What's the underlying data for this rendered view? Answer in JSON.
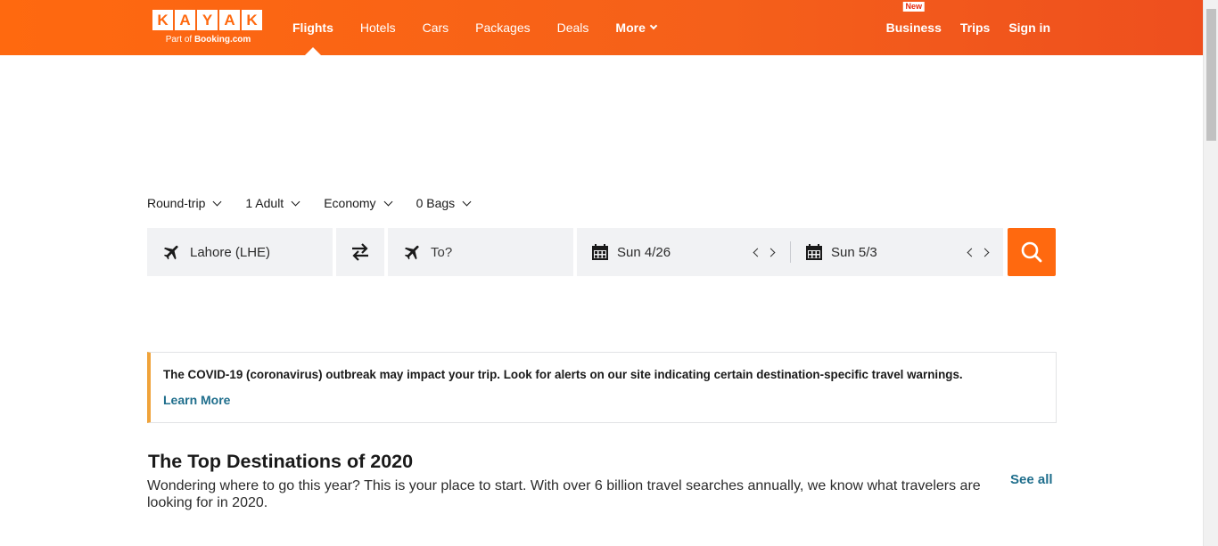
{
  "brand": {
    "letters": [
      "K",
      "A",
      "Y",
      "A",
      "K"
    ],
    "tagline_prefix": "Part of ",
    "tagline_brand": "Booking.com"
  },
  "nav": {
    "items": [
      {
        "label": "Flights"
      },
      {
        "label": "Hotels"
      },
      {
        "label": "Cars"
      },
      {
        "label": "Packages"
      },
      {
        "label": "Deals"
      },
      {
        "label": "More"
      }
    ],
    "active": "Flights"
  },
  "account": {
    "business_badge": "New",
    "business_label": "Business",
    "trips_label": "Trips",
    "signin_label": "Sign in"
  },
  "search": {
    "options": {
      "trip_type": "Round-trip",
      "travelers": "1 Adult",
      "cabin": "Economy",
      "bags": "0 Bags"
    },
    "origin": "Lahore (LHE)",
    "destination_placeholder": "To?",
    "depart_date": "Sun 4/26",
    "return_date": "Sun 5/3"
  },
  "alert": {
    "message": "The COVID-19 (coronavirus) outbreak may impact your trip. Look for alerts on our site indicating certain destination-specific travel warnings.",
    "link": "Learn More"
  },
  "destinations": {
    "title": "The Top Destinations of 2020",
    "description": "Wondering where to go this year? This is your place to start. With over 6 billion travel searches annually, we know what travelers are looking for in 2020.",
    "see_all": "See all"
  },
  "colors": {
    "brand_orange": "#ff690f",
    "link_blue": "#1f6e8c",
    "alert_accent": "#f0a33a",
    "field_bg": "#f1f2f4"
  }
}
